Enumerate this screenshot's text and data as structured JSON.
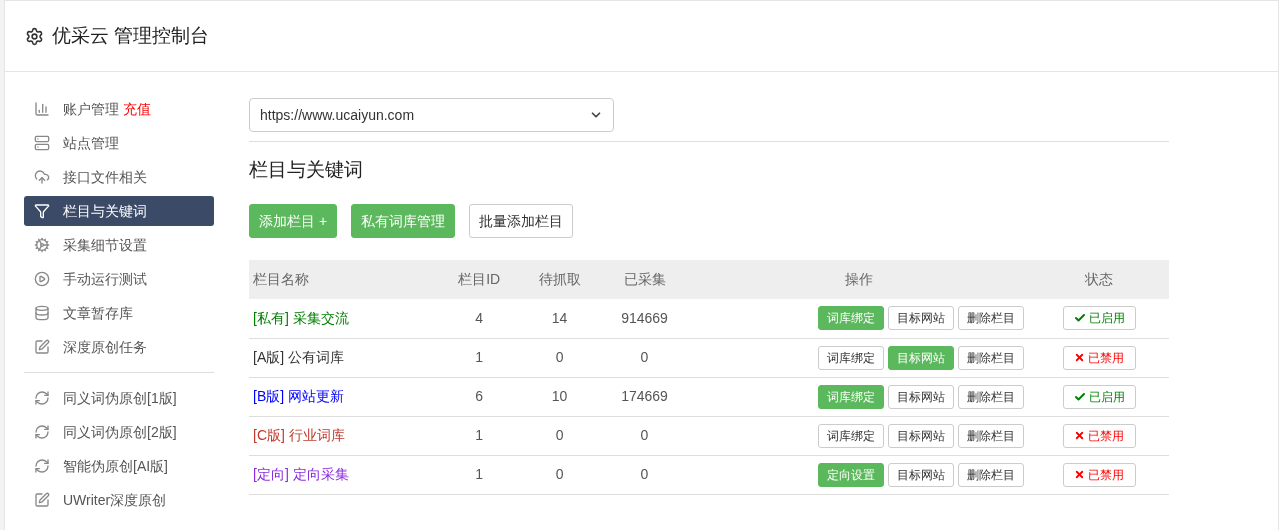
{
  "header": {
    "title": "优采云 管理控制台"
  },
  "sidebar": {
    "groups": [
      [
        {
          "kind": "chart",
          "label": "账户管理",
          "badge": "充值",
          "selected": false
        },
        {
          "kind": "server",
          "label": "站点管理",
          "selected": false
        },
        {
          "kind": "cloud",
          "label": "接口文件相关",
          "selected": false
        },
        {
          "kind": "filter",
          "label": "栏目与关键词",
          "selected": true
        },
        {
          "kind": "gears",
          "label": "采集细节设置",
          "selected": false
        },
        {
          "kind": "play",
          "label": "手动运行测试",
          "selected": false
        },
        {
          "kind": "database",
          "label": "文章暂存库",
          "selected": false
        },
        {
          "kind": "edit",
          "label": "深度原创任务",
          "selected": false
        }
      ],
      [
        {
          "kind": "refresh",
          "label": "同义词伪原创[1版]",
          "selected": false
        },
        {
          "kind": "refresh",
          "label": "同义词伪原创[2版]",
          "selected": false
        },
        {
          "kind": "refresh",
          "label": "智能伪原创[AI版]",
          "selected": false
        },
        {
          "kind": "edit",
          "label": "UWriter深度原创",
          "selected": false
        }
      ]
    ]
  },
  "site_select": {
    "value": "https://www.ucaiyun.com"
  },
  "section_title": "栏目与关键词",
  "toolbar": [
    {
      "label": "添加栏目 +",
      "primary": true
    },
    {
      "label": "私有词库管理",
      "primary": true
    },
    {
      "label": "批量添加栏目",
      "primary": false
    }
  ],
  "table": {
    "columns": [
      "栏目名称",
      "栏目ID",
      "待抓取",
      "已采集",
      "操作",
      "状态"
    ],
    "rows": [
      {
        "tag": "[私有]",
        "name": "采集交流",
        "color": "#008000",
        "id": "4",
        "pending": "14",
        "collected": "914669",
        "actions": [
          {
            "label": "词库绑定",
            "primary": true
          },
          {
            "label": "目标网站",
            "primary": false
          },
          {
            "label": "删除栏目",
            "primary": false
          }
        ],
        "status": "已启用",
        "enabled": true
      },
      {
        "tag": "[A版]",
        "name": "公有词库",
        "color": "#333333",
        "id": "1",
        "pending": "0",
        "collected": "0",
        "actions": [
          {
            "label": "词库绑定",
            "primary": false
          },
          {
            "label": "目标网站",
            "primary": true
          },
          {
            "label": "删除栏目",
            "primary": false
          }
        ],
        "status": "已禁用",
        "enabled": false
      },
      {
        "tag": "[B版]",
        "name": "网站更新",
        "color": "#0000ff",
        "id": "6",
        "pending": "10",
        "collected": "174669",
        "actions": [
          {
            "label": "词库绑定",
            "primary": true
          },
          {
            "label": "目标网站",
            "primary": false
          },
          {
            "label": "删除栏目",
            "primary": false
          }
        ],
        "status": "已启用",
        "enabled": true
      },
      {
        "tag": "[C版]",
        "name": "行业词库",
        "color": "#c0392b",
        "id": "1",
        "pending": "0",
        "collected": "0",
        "actions": [
          {
            "label": "词库绑定",
            "primary": false
          },
          {
            "label": "目标网站",
            "primary": false
          },
          {
            "label": "删除栏目",
            "primary": false
          }
        ],
        "status": "已禁用",
        "enabled": false
      },
      {
        "tag": "[定向]",
        "name": "定向采集",
        "color": "#8a2be2",
        "id": "1",
        "pending": "0",
        "collected": "0",
        "actions": [
          {
            "label": "定向设置",
            "primary": true
          },
          {
            "label": "目标网站",
            "primary": false
          },
          {
            "label": "删除栏目",
            "primary": false
          }
        ],
        "status": "已禁用",
        "enabled": false
      }
    ]
  }
}
